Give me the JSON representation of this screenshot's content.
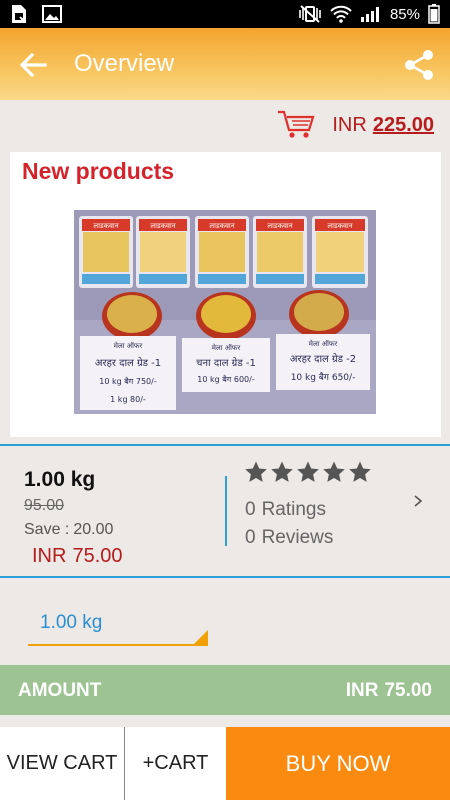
{
  "status_bar": {
    "battery": "85%",
    "icons": [
      "sim-card-icon",
      "image-icon",
      "vibrate-mute-icon",
      "wifi-icon",
      "signal-icon",
      "battery-icon"
    ]
  },
  "app_bar": {
    "title": "Overview",
    "back_icon": "arrow-left-icon",
    "share_icon": "share-icon"
  },
  "cart_price": {
    "currency": "INR",
    "amount": "225.00",
    "icon": "shopping-cart-icon"
  },
  "product_card": {
    "heading": "New products",
    "image": {
      "packet_label": "लाडकवान",
      "offers": [
        {
          "head": "मेला ऑफर",
          "line1": "अरहर दाल ग्रेड -1",
          "line2": "10 kg बैग 750/-",
          "line3": "1 kg 80/-"
        },
        {
          "head": "मेला ऑफर",
          "line1": "चना दाल ग्रेड -1",
          "line2": "10 kg बैग 600/-",
          "line3": ""
        },
        {
          "head": "मेला ऑफर",
          "line1": "अरहर दाल ग्रेड -2",
          "line2": "10 kg बैग 650/-",
          "line3": ""
        }
      ]
    }
  },
  "details": {
    "weight": "1.00 kg",
    "mrp": "95.00",
    "save_label": "Save :",
    "save_value": "20.00",
    "offer_currency": "INR",
    "offer_price": "75.00",
    "star_count": 5,
    "ratings_count": "0",
    "ratings_label": "Ratings",
    "reviews_count": "0",
    "reviews_label": "Reviews",
    "colors": {
      "accent_blue": "#2b9fd6",
      "price_red": "#b51c1c"
    }
  },
  "quantity_select": {
    "value": "1.00 kg"
  },
  "amount_bar": {
    "label": "AMOUNT",
    "currency": "INR",
    "value": "75.00",
    "color": "#9cc391"
  },
  "bottom_bar": {
    "view_cart": "VIEW CART",
    "add_cart": "+CART",
    "buy_now": "BUY NOW",
    "buy_color": "#fb8a10"
  }
}
